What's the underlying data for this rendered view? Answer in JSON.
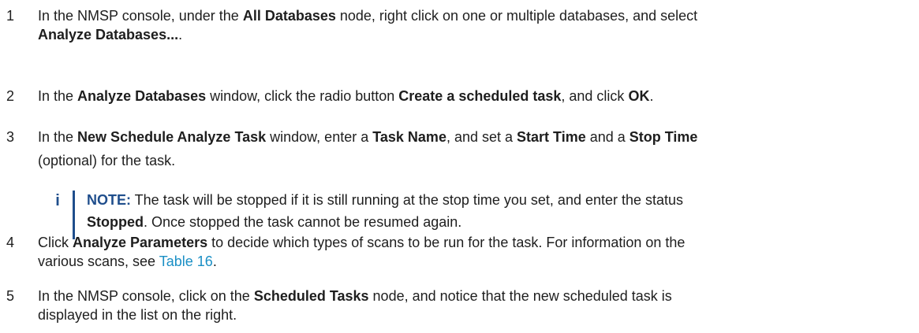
{
  "steps": [
    {
      "number": "1",
      "line1": {
        "t1": "In the NMSP console, under the ",
        "b1": "All Databases",
        "t2": " node, right click on one or multiple databases, and select"
      },
      "line2": {
        "b1": "Analyze Databases...",
        "t1": "."
      }
    },
    {
      "number": "2",
      "line1": {
        "t1": "In the ",
        "b1": "Analyze Databases",
        "t2": " window, click the radio button ",
        "b2": "Create a scheduled task",
        "t3": ", and click ",
        "b3": "OK",
        "t4": "."
      }
    },
    {
      "number": "3",
      "line1": {
        "t1": "In the ",
        "b1": "New Schedule Analyze Task",
        "t2": " window, enter a ",
        "b2": "Task Name",
        "t3": ", and set a ",
        "b3": "Start Time",
        "t4": " and a ",
        "b4": "Stop Time"
      },
      "line2": {
        "t1": "(optional) for the task."
      }
    },
    {
      "number": "4",
      "line1": {
        "t1": "Click ",
        "b1": "Analyze Parameters",
        "t2": " to decide which types of scans to be run for the task. For information on the"
      },
      "line2": {
        "t1": "various scans, see ",
        "link": "Table 16",
        "t2": "."
      }
    },
    {
      "number": "5",
      "line1": {
        "t1": "In the NMSP console, click on the ",
        "b1": "Scheduled Tasks",
        "t2": " node, and notice that the new scheduled task is"
      },
      "line2": {
        "t1": "displayed in the list on the right."
      }
    }
  ],
  "note": {
    "icon": "info-icon",
    "label": "NOTE:",
    "line1": " The task will be stopped if it is still running at the stop time you set, and enter the status",
    "line2_bold": "Stopped",
    "line2": ". Once stopped the task cannot be resumed again."
  },
  "colors": {
    "text": "#1e1e1e",
    "link": "#1a8fc5",
    "note_accent": "#1f4e8c"
  }
}
